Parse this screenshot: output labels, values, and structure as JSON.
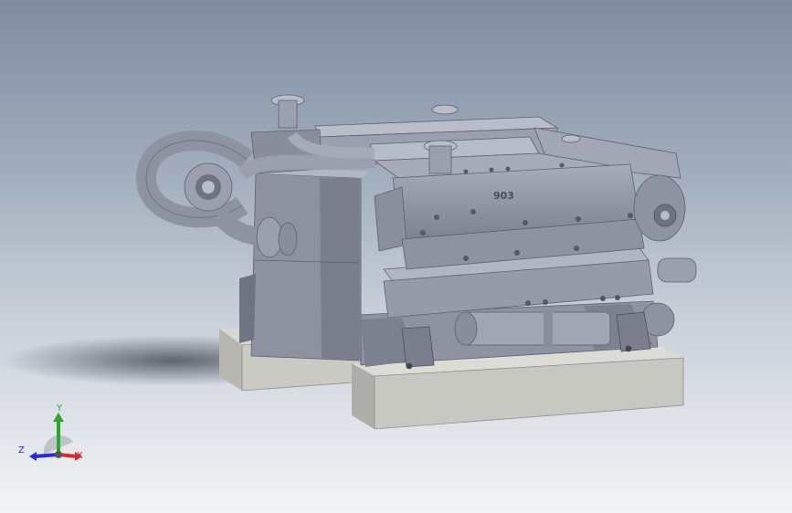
{
  "viewport": {
    "background_top": "#7f8da1",
    "background_bottom": "#f3f4f6"
  },
  "model": {
    "body_color": "#9a9fae",
    "body_dark": "#6e7382",
    "body_light": "#c3c7d2",
    "base_color": "#c9c9c3",
    "base_dark": "#8f8f88",
    "valve_cover_marking": "903"
  },
  "triad": {
    "x_label": "X",
    "y_label": "Y",
    "z_label": "Z",
    "x_color": "#d62b2b",
    "y_color": "#2aa82a",
    "z_color": "#2b2bd6"
  }
}
